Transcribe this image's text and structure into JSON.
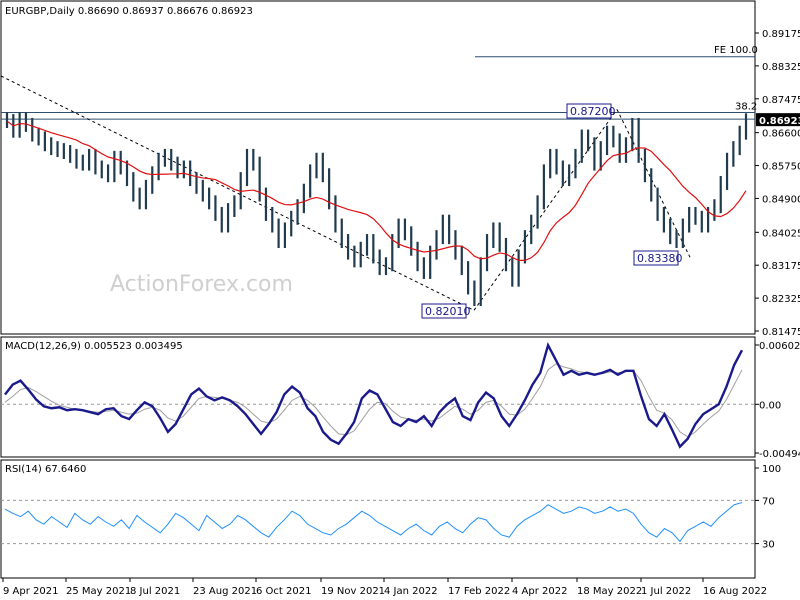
{
  "chart_data": [
    {
      "type": "candlestick",
      "title": "EURGBP,Daily",
      "ohlc": {
        "open": "0.86690",
        "high": "0.86937",
        "low": "0.86676",
        "close": "0.86923"
      },
      "last_price": "0.86923",
      "y_ticks": [
        "0.89175",
        "0.88325",
        "0.87475",
        "0.86600",
        "0.85750",
        "0.84900",
        "0.84025",
        "0.83175",
        "0.82325",
        "0.81475"
      ],
      "ylim": [
        0.81475,
        0.89175
      ],
      "x_ticks": [
        "9 Apr 2021",
        "25 May 2021",
        "8 Jul 2021",
        "23 Aug 2021",
        "6 Oct 2021",
        "19 Nov 2021",
        "4 Jan 2022",
        "17 Feb 2022",
        "4 Apr 2022",
        "18 May 2022",
        "1 Jul 2022",
        "16 Aug 2022"
      ],
      "annotations": [
        {
          "text": "0.87200",
          "x": "17 May 2022",
          "y": 0.872
        },
        {
          "text": "0.82010",
          "x": "17 Feb 2022",
          "y": 0.8201
        },
        {
          "text": "0.83380",
          "x": "14 Jul 2022",
          "y": 0.8338
        }
      ],
      "levels": [
        {
          "text": "FE 100.0",
          "y": 0.8856
        },
        {
          "text": "38.2",
          "y": 0.8712
        },
        {
          "text": "",
          "y": 0.8695
        }
      ],
      "closes": [
        0.869,
        0.8665,
        0.8695,
        0.868,
        0.8655,
        0.8645,
        0.863,
        0.862,
        0.8615,
        0.861,
        0.86,
        0.8585,
        0.858,
        0.86,
        0.857,
        0.856,
        0.855,
        0.8595,
        0.857,
        0.854,
        0.85,
        0.848,
        0.852,
        0.8555,
        0.859,
        0.86,
        0.858,
        0.856,
        0.857,
        0.854,
        0.852,
        0.85,
        0.848,
        0.845,
        0.842,
        0.846,
        0.848,
        0.854,
        0.86,
        0.858,
        0.85,
        0.845,
        0.842,
        0.838,
        0.841,
        0.844,
        0.847,
        0.851,
        0.856,
        0.859,
        0.855,
        0.848,
        0.842,
        0.838,
        0.835,
        0.833,
        0.836,
        0.838,
        0.834,
        0.831,
        0.832,
        0.838,
        0.842,
        0.84,
        0.836,
        0.832,
        0.83,
        0.835,
        0.839,
        0.843,
        0.839,
        0.835,
        0.831,
        0.826,
        0.823,
        0.832,
        0.838,
        0.841,
        0.837,
        0.832,
        0.828,
        0.834,
        0.839,
        0.843,
        0.848,
        0.856,
        0.86,
        0.857,
        0.854,
        0.856,
        0.86,
        0.865,
        0.863,
        0.858,
        0.862,
        0.866,
        0.864,
        0.86,
        0.863,
        0.868,
        0.86,
        0.855,
        0.85,
        0.845,
        0.842,
        0.839,
        0.838,
        0.842,
        0.845,
        0.844,
        0.842,
        0.845,
        0.847,
        0.853,
        0.859,
        0.862,
        0.866,
        0.8692
      ]
    },
    {
      "type": "line",
      "title": "MACD(12,26,9) 0.005523 0.003495",
      "y_ticks": [
        "0.006021",
        "0.00",
        "-0.004944"
      ],
      "ylim": [
        -0.004944,
        0.006021
      ],
      "series": [
        {
          "values": [
            0.001,
            0.002,
            0.0024,
            0.0015,
            0.0005,
            -0.0002,
            -0.0004,
            -0.0003,
            -0.0006,
            -0.0005,
            -0.0006,
            -0.0008,
            -0.001,
            -0.0005,
            -0.0004,
            -0.0012,
            -0.0015,
            -0.0006,
            0.0002,
            -0.0002,
            -0.0014,
            -0.0028,
            -0.002,
            -0.0005,
            0.001,
            0.0016,
            0.0008,
            0.0004,
            0.0007,
            0.0004,
            -0.0002,
            -0.001,
            -0.002,
            -0.003,
            -0.002,
            -0.0008,
            0.001,
            0.0018,
            0.0012,
            -0.0004,
            -0.0012,
            -0.0028,
            -0.0036,
            -0.004,
            -0.003,
            -0.0018,
            0.0006,
            0.0014,
            0.001,
            -0.0004,
            -0.0018,
            -0.0022,
            -0.0015,
            -0.0018,
            -0.0012,
            -0.0022,
            -0.0008,
            0.0,
            0.0006,
            -0.0012,
            -0.0016,
            0.0002,
            0.0012,
            0.0006,
            -0.0012,
            -0.0022,
            -0.001,
            0.0004,
            0.002,
            0.0032,
            0.006,
            0.0045,
            0.003,
            0.0034,
            0.003,
            0.0032,
            0.003,
            0.0032,
            0.0035,
            0.003,
            0.0034,
            0.0034,
            0.0008,
            -0.0015,
            -0.0022,
            -0.001,
            -0.0026,
            -0.0043,
            -0.0035,
            -0.002,
            -0.001,
            -0.0005,
            0.0,
            0.0018,
            0.004,
            0.0055
          ]
        },
        {
          "values": [
            0.0002,
            0.0008,
            0.0015,
            0.0017,
            0.0013,
            0.0008,
            0.0003,
            -0.0001,
            -0.0003,
            -0.0005,
            -0.0006,
            -0.0007,
            -0.0008,
            -0.0007,
            -0.0006,
            -0.0008,
            -0.001,
            -0.0009,
            -0.0005,
            -0.0003,
            -0.0006,
            -0.0014,
            -0.0017,
            -0.0012,
            -0.0003,
            0.0006,
            0.0008,
            0.0007,
            0.0006,
            0.0004,
            0.0002,
            -0.0003,
            -0.001,
            -0.0017,
            -0.0019,
            -0.0015,
            -0.0006,
            0.0004,
            0.0008,
            0.0004,
            -0.0003,
            -0.0013,
            -0.0022,
            -0.003,
            -0.0031,
            -0.0027,
            -0.0016,
            -0.0005,
            0.0002,
            0.0001,
            -0.0007,
            -0.0013,
            -0.0015,
            -0.0016,
            -0.0015,
            -0.0017,
            -0.0014,
            -0.0008,
            -0.0002,
            -0.0005,
            -0.001,
            -0.0006,
            0.0002,
            0.0004,
            -0.0002,
            -0.001,
            -0.0011,
            -0.0005,
            0.0006,
            0.0018,
            0.0035,
            0.0041,
            0.0038,
            0.0036,
            0.0033,
            0.0032,
            0.0031,
            0.0031,
            0.0033,
            0.0032,
            0.0033,
            0.0034,
            0.0024,
            0.0008,
            -0.0006,
            -0.0009,
            -0.0016,
            -0.0028,
            -0.0033,
            -0.0028,
            -0.002,
            -0.0013,
            -0.0007,
            0.0005,
            0.002,
            0.0035
          ]
        }
      ]
    },
    {
      "type": "line",
      "title": "RSI(14) 67.6460",
      "y_ticks": [
        "100",
        "70",
        "30",
        "0"
      ],
      "ylim": [
        0,
        100
      ],
      "values": [
        62,
        58,
        55,
        60,
        52,
        48,
        55,
        50,
        45,
        58,
        52,
        48,
        55,
        50,
        46,
        52,
        44,
        56,
        50,
        45,
        40,
        48,
        58,
        54,
        48,
        42,
        56,
        50,
        44,
        48,
        56,
        52,
        46,
        40,
        36,
        45,
        52,
        60,
        56,
        48,
        44,
        40,
        38,
        44,
        48,
        54,
        60,
        56,
        50,
        46,
        42,
        38,
        44,
        48,
        42,
        38,
        46,
        50,
        44,
        40,
        48,
        54,
        52,
        44,
        38,
        36,
        46,
        52,
        56,
        60,
        66,
        62,
        58,
        60,
        64,
        62,
        58,
        60,
        64,
        60,
        62,
        58,
        48,
        40,
        36,
        44,
        40,
        32,
        42,
        46,
        50,
        46,
        54,
        60,
        66,
        68
      ]
    }
  ],
  "watermark": "ActionForex.com"
}
